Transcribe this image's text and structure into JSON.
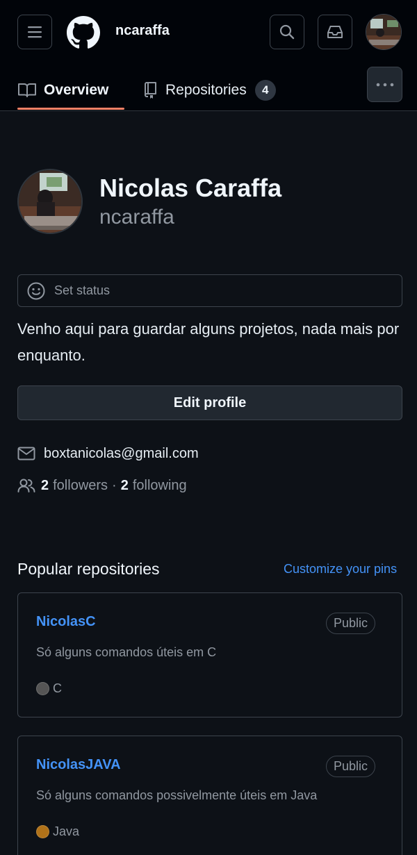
{
  "header": {
    "username": "ncaraffa",
    "icons": {
      "menu": "hamburger-menu-icon",
      "logo": "github-logo-icon",
      "search": "search-icon",
      "inbox": "inbox-icon"
    }
  },
  "tabs": [
    {
      "label": "Overview",
      "icon": "book-icon",
      "selected": true
    },
    {
      "label": "Repositories",
      "icon": "repo-icon",
      "count": "4"
    }
  ],
  "profile": {
    "full_name": "Nicolas Caraffa",
    "login": "ncaraffa",
    "status_label": "Set status",
    "bio": "Venho aqui para guardar alguns projetos, nada mais por enquanto.",
    "edit_label": "Edit profile",
    "email": "boxtanicolas@gmail.com",
    "followers_count": "2",
    "followers_label": "followers",
    "separator": "·",
    "following_count": "2",
    "following_label": "following"
  },
  "popular": {
    "title": "Popular repositories",
    "customize_label": "Customize your pins",
    "repos": [
      {
        "name": "NicolasC",
        "visibility": "Public",
        "description": "Só alguns comandos úteis em C",
        "language": "C",
        "language_color": "#555555"
      },
      {
        "name": "NicolasJAVA",
        "visibility": "Public",
        "description": "Só alguns comandos possivelmente úteis em Java",
        "language": "Java",
        "language_color": "#b07219"
      }
    ]
  },
  "colors": {
    "background": "#0d1117",
    "header_bg": "#010409",
    "accent_link": "#4493f8",
    "tab_underline": "#f78166"
  }
}
